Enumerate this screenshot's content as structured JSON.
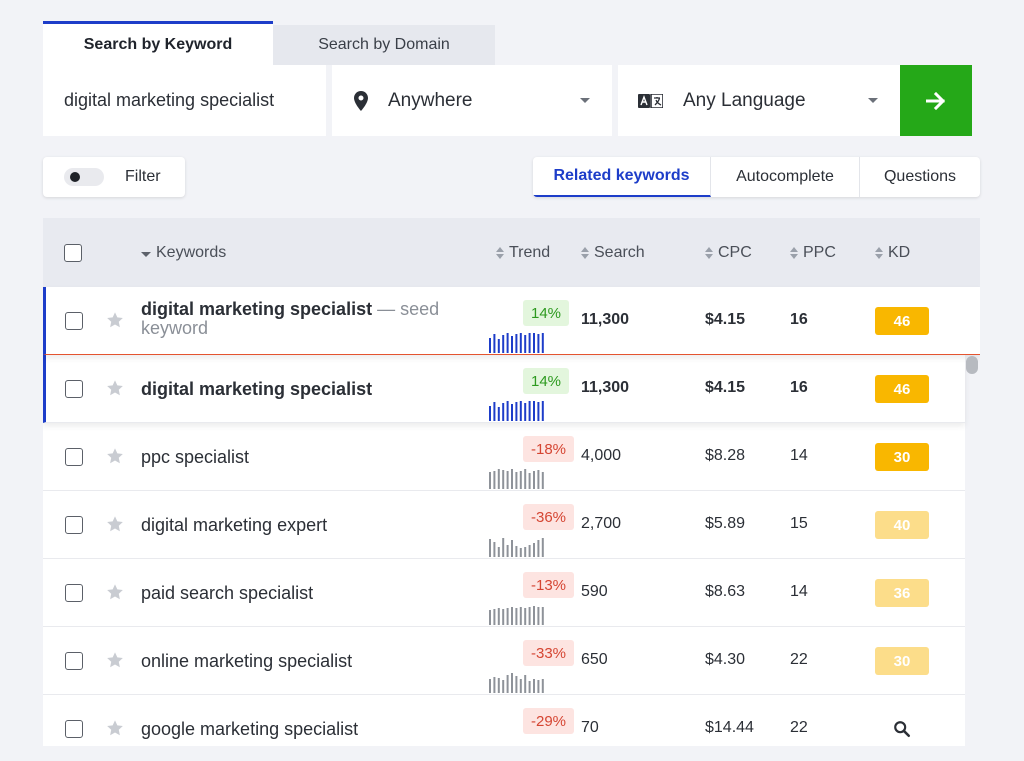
{
  "search_tabs": {
    "keyword": "Search by Keyword",
    "domain": "Search by Domain"
  },
  "search": {
    "keyword_value": "digital marketing specialist",
    "location": "Anywhere",
    "language": "Any Language"
  },
  "filter": {
    "label": "Filter"
  },
  "mode_tabs": {
    "related": "Related keywords",
    "autocomplete": "Autocomplete",
    "questions": "Questions"
  },
  "columns": {
    "keywords": "Keywords",
    "trend": "Trend",
    "search": "Search",
    "cpc": "CPC",
    "ppc": "PPC",
    "kd": "KD"
  },
  "seed_row": {
    "keyword": "digital marketing specialist",
    "note": " — seed keyword",
    "trend": "14%",
    "search": "11,300",
    "cpc": "$4.15",
    "ppc": "16",
    "kd": "46"
  },
  "rows": [
    {
      "keyword": "digital marketing specialist",
      "trend": "14%",
      "search": "11,300",
      "cpc": "$4.15",
      "ppc": "16",
      "kd": "46"
    },
    {
      "keyword": "ppc specialist",
      "trend": "-18%",
      "search": "4,000",
      "cpc": "$8.28",
      "ppc": "14",
      "kd": "30"
    },
    {
      "keyword": "digital marketing expert",
      "trend": "-36%",
      "search": "2,700",
      "cpc": "$5.89",
      "ppc": "15",
      "kd": "40"
    },
    {
      "keyword": "paid search specialist",
      "trend": "-13%",
      "search": "590",
      "cpc": "$8.63",
      "ppc": "14",
      "kd": "36"
    },
    {
      "keyword": "online marketing specialist",
      "trend": "-33%",
      "search": "650",
      "cpc": "$4.30",
      "ppc": "22",
      "kd": "30"
    },
    {
      "keyword": "google marketing specialist",
      "trend": "-29%",
      "search": "70",
      "cpc": "$14.44",
      "ppc": "22",
      "kd": ""
    }
  ],
  "colors": {
    "accent_blue": "#1d3dc9",
    "go_green": "#25a818",
    "kd_strong": "#f9b700",
    "kd_light": "#fcdd8a",
    "trend_up": "#2d9a1f",
    "trend_down": "#d54532",
    "spark_blue": "#1d3dc9",
    "spark_gray": "#8e9299"
  },
  "icons": {
    "location": "map-pin-icon",
    "language": "translate-icon",
    "go": "arrow-right-icon",
    "star": "star-icon",
    "kd_missing": "magnifier-icon"
  }
}
